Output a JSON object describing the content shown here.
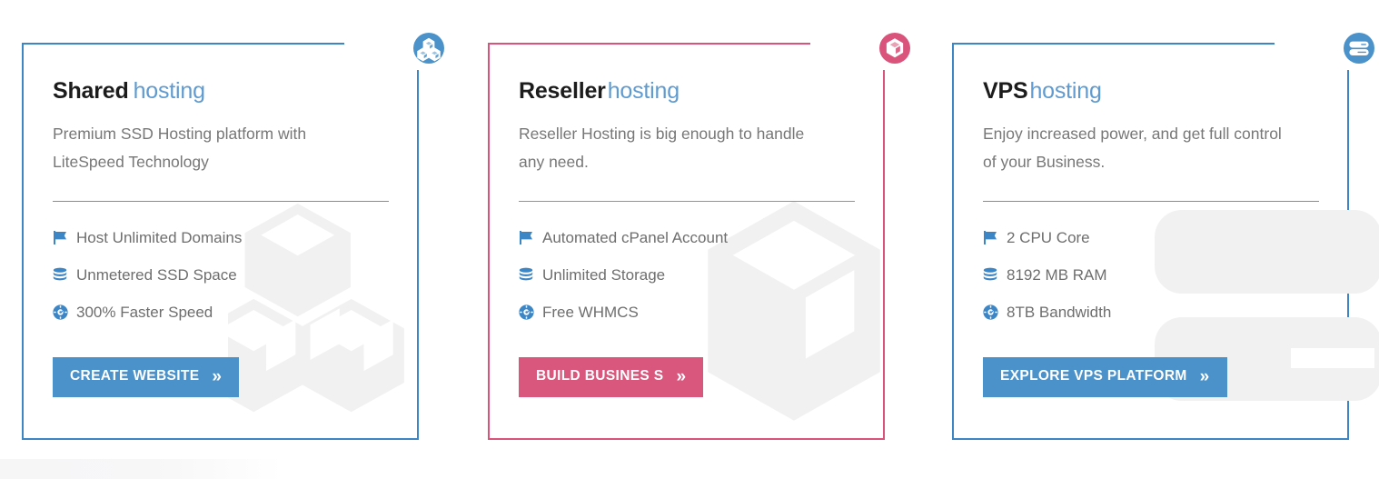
{
  "palette": {
    "blue": "#3d86c6",
    "blue_light": "#5f9bd0",
    "pink": "#d9537a",
    "button_blue": "#4a92c9",
    "button_pink": "#d9577d",
    "text_dark": "#1c1c1c",
    "text_gray": "#777777",
    "watermark_gray": "#f1f1f2",
    "band_gray": "#f6f6f7"
  },
  "cards": [
    {
      "id": "shared-hosting",
      "accent": "#3d86c6",
      "badge_icon": "cubes-stack-icon",
      "watermark_icon": "cubes-stack-watermark",
      "title_strong": "Shared",
      "title_light": "hosting",
      "description": "Premium SSD Hosting platform with LiteSpeed Technology",
      "features": [
        {
          "icon": "flag-icon",
          "label": "Host Unlimited Domains"
        },
        {
          "icon": "database-stack-icon",
          "label": "Unmetered SSD Space"
        },
        {
          "icon": "speedometer-icon",
          "label": "300% Faster Speed"
        }
      ],
      "cta_label": "CREATE WEBSITE",
      "cta_chevron": "»",
      "cta_color": "#4a92c9"
    },
    {
      "id": "reseller-hosting",
      "accent": "#d9537a",
      "badge_icon": "box-icon",
      "watermark_icon": "box-watermark",
      "title_strong": "Reseller",
      "title_light": "hosting",
      "description": "Reseller Hosting is big enough to handle any need.",
      "features": [
        {
          "icon": "flag-icon",
          "label": "Automated cPanel Account"
        },
        {
          "icon": "database-stack-icon",
          "label": "Unlimited Storage"
        },
        {
          "icon": "speedometer-icon",
          "label": "Free WHMCS"
        }
      ],
      "cta_label": "BUILD BUSINES S",
      "cta_chevron": "»",
      "cta_color": "#d9577d"
    },
    {
      "id": "vps-hosting",
      "accent": "#3d86c6",
      "badge_icon": "server-rack-icon",
      "watermark_icon": "server-rack-watermark",
      "title_strong": "VPS",
      "title_light": "hosting",
      "description": "Enjoy increased power, and get full control of your Business.",
      "features": [
        {
          "icon": "flag-icon",
          "label": "2 CPU Core"
        },
        {
          "icon": "database-stack-icon",
          "label": "8192 MB RAM"
        },
        {
          "icon": "speedometer-icon",
          "label": "8TB Bandwidth"
        }
      ],
      "cta_label": "EXPLORE VPS PLATFORM",
      "cta_chevron": "»",
      "cta_color": "#4a92c9"
    }
  ]
}
